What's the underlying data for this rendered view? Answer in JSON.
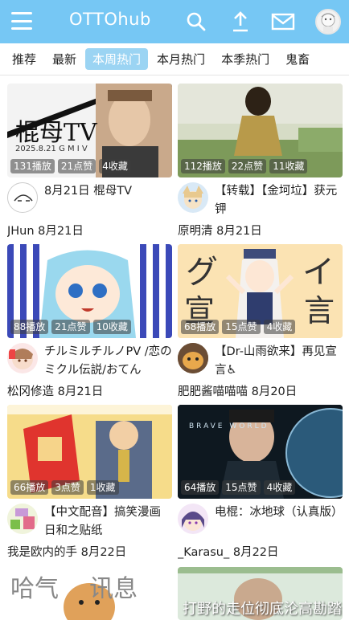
{
  "app": {
    "title": "OTTOhub"
  },
  "toolbar": {
    "menu_icon": "menu-icon",
    "search_icon": "search-icon",
    "upload_icon": "upload-icon",
    "mail_icon": "mail-icon",
    "accent_color": "#76c7f4"
  },
  "tabs": [
    {
      "label": "推荐",
      "active": false
    },
    {
      "label": "最新",
      "active": false
    },
    {
      "label": "本周热门",
      "active": true
    },
    {
      "label": "本月热门",
      "active": false
    },
    {
      "label": "本季热门",
      "active": false
    },
    {
      "label": "鬼畜",
      "active": false
    }
  ],
  "videos": [
    {
      "thumb_text": "棍母TV",
      "thumb_subtext": "2025.8.21  G M I V",
      "views": "131播放",
      "likes": "21点赞",
      "favs": "4收藏",
      "title": "8月21日 棍母TV",
      "author": "JHun",
      "date": "8月21日"
    },
    {
      "views": "112播放",
      "likes": "22点赞",
      "favs": "11收藏",
      "title": "【转载】【金坷垃】获元钾",
      "author": "原明清",
      "date": "8月21日"
    },
    {
      "views": "88播放",
      "likes": "21点赞",
      "favs": "10收藏",
      "title": "チルミルチルノPV /恋のミクル伝説/おてん",
      "author": "松冈修造",
      "date": "8月21日"
    },
    {
      "thumb_text_left": "グ",
      "thumb_text_right": "イ",
      "thumb_text_bottom_left": "宣",
      "thumb_text_bottom_right": "言",
      "views": "68播放",
      "likes": "15点赞",
      "favs": "4收藏",
      "title": "【Dr-山雨欲来】再见宣言♿",
      "author": "肥肥酱喵喵喵",
      "date": "8月20日"
    },
    {
      "views": "66播放",
      "likes": "3点赞",
      "favs": "1收藏",
      "title": "【中文配音】搞笑漫画日和之贴纸",
      "author": "我是欧内的手",
      "date": "8月22日"
    },
    {
      "thumb_text": "BRAVE          WORLD",
      "views": "64播放",
      "likes": "15点赞",
      "favs": "4收藏",
      "title": "电棍：冰地球（认真版）",
      "author": "_Karasu_",
      "date": "8月22日"
    }
  ],
  "partial_row": {
    "left_text": "哈气    讯息",
    "right_text": "打野的走位彻底沦高勘踏"
  }
}
